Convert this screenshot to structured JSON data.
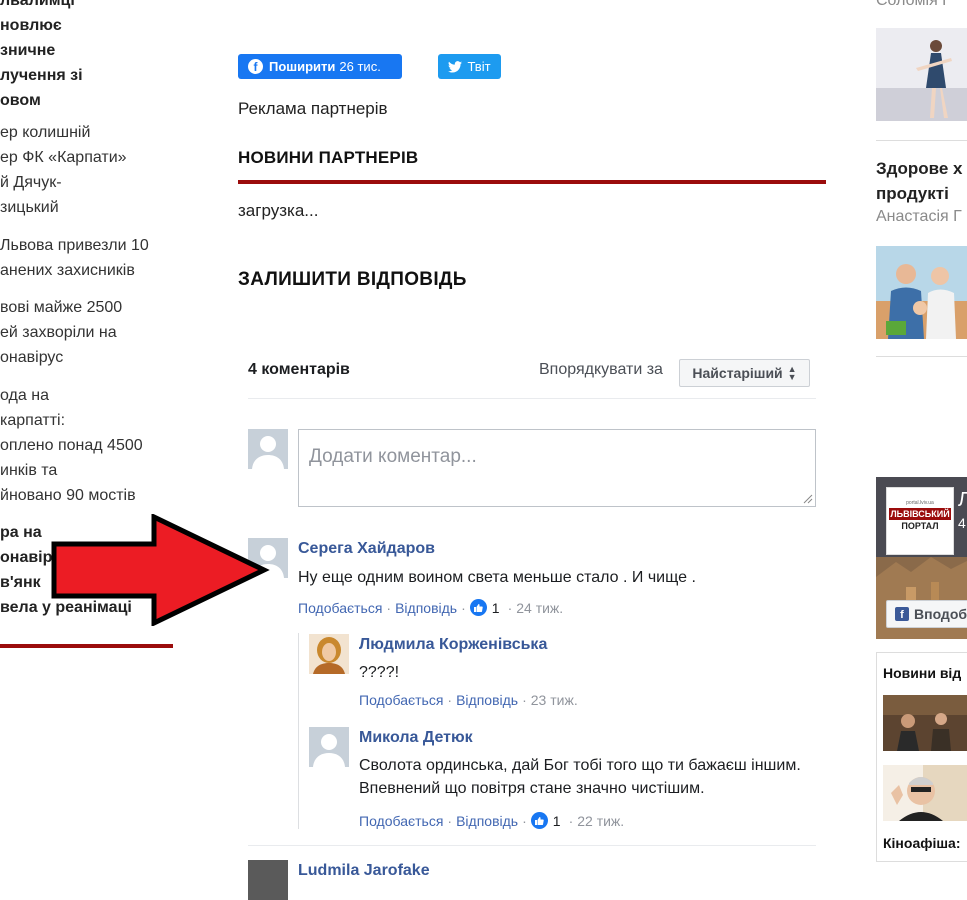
{
  "left_column": {
    "items": [
      {
        "lines": [
          "лвалимці",
          "новлює",
          "зничне",
          "лучення зі",
          "овом"
        ],
        "bold": true
      },
      {
        "lines": [
          "ер колишній",
          "ер ФК «Карпати»",
          "й Дячук-",
          "зицький"
        ],
        "bold": false
      },
      {
        "lines": [
          "Львова привезли 10",
          "анених захисників"
        ],
        "bold": false
      },
      {
        "lines": [
          "вові майже 2500",
          "ей захворіли на",
          "онавірус"
        ],
        "bold": false
      },
      {
        "lines": [
          "ода на",
          "карпатті:",
          "оплено понад 4500",
          "инків та",
          "йновано 90 мостів"
        ],
        "bold": false
      },
      {
        "lines": [
          "ра на",
          "онавір",
          "в'янк",
          "вела у реанімаці"
        ],
        "bold": true
      }
    ]
  },
  "share": {
    "fb_label": "Поширити",
    "fb_count": "26 тис.",
    "tweet_label": "Твіт"
  },
  "partners": {
    "ad_label": "Реклама партнерів",
    "news_title": "НОВИНИ ПАРТНЕРІВ",
    "loading": "загрузка..."
  },
  "reply": {
    "title": "ЗАЛИШИТИ ВІДПОВІДЬ"
  },
  "comments": {
    "count_label": "4 коментарів",
    "sort_label": "Впорядкувати за",
    "sort_value": "Найстаріший",
    "compose_placeholder": "Додати коментар...",
    "like_label": "Подобається",
    "reply_label": "Відповідь",
    "items": [
      {
        "author": "Серега Хайдаров",
        "text": "Ну еще одним воином света меньше стало . И чище .",
        "likes": "1",
        "time": "24 тиж."
      },
      {
        "author": "Людмила Корженівська",
        "text": "????!",
        "likes": "",
        "time": "23 тиж."
      },
      {
        "author": "Микола Детюк",
        "text": "Сволота ординська, дай Бог тобі того що ти бажаєш іншим. Впевнений що повітря стане значно чистішим.",
        "likes": "1",
        "time": "22 тиж."
      }
    ],
    "next_author": "Ludmila Jarofake"
  },
  "right_column": {
    "top_author": "Соломія Г",
    "article_title_lines": [
      "Здорове х",
      "продукті"
    ],
    "article_author": "Анастасія Г",
    "fb_page": {
      "logo_top": "portal.lviv.ua",
      "logo_mid": "ЛЬВІВСЬКИЙ",
      "logo_bottom": "ПОРТАЛ",
      "name": "Л",
      "count": "4",
      "follow_label": "Вподоб"
    },
    "news_widget_title": "Новини від",
    "news_widget_footer": "Кіноафіша:"
  },
  "colors": {
    "accent_red": "#9b0c0c",
    "facebook_blue": "#1877f2",
    "twitter_blue": "#1d9bf0",
    "link_blue": "#385898",
    "arrow_red": "#ec1c24"
  }
}
